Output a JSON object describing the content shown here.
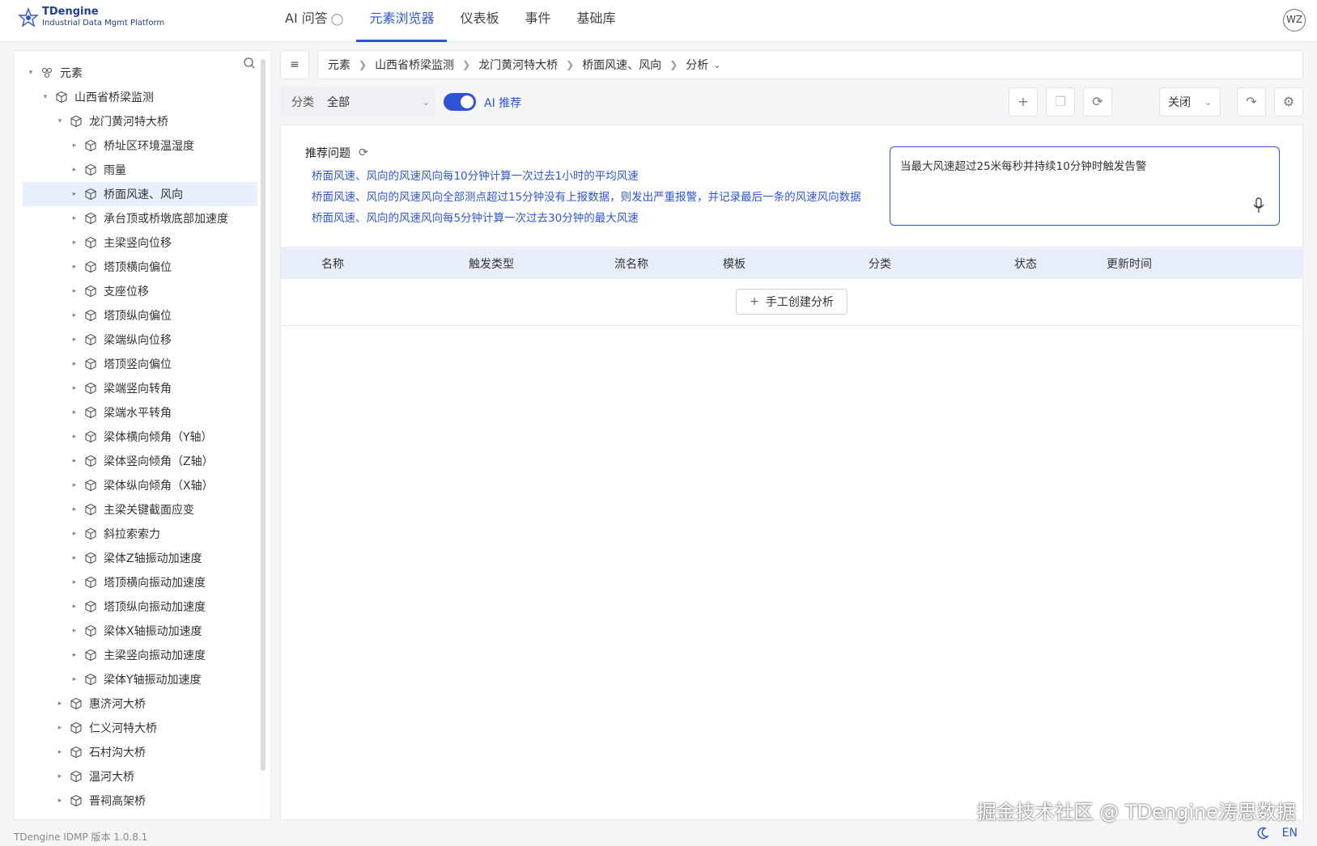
{
  "app": {
    "logo_title": "TDengine",
    "logo_subtitle": "Industrial Data Mgmt Platform",
    "avatar": "WZ",
    "version_text": "TDengine IDMP 版本 1.0.8.1",
    "lang": "EN",
    "watermark": "掘金技术社区 @ TDengine涛思数据"
  },
  "nav": [
    {
      "label": "AI 问答",
      "icon": "bulb-icon",
      "active": false
    },
    {
      "label": "元素浏览器",
      "active": true
    },
    {
      "label": "仪表板",
      "active": false
    },
    {
      "label": "事件",
      "active": false
    },
    {
      "label": "基础库",
      "active": false
    }
  ],
  "tree": {
    "root": "元素",
    "level1": "山西省桥梁监测",
    "level2": "龙门黄河特大桥",
    "children": [
      "桥址区环境温湿度",
      "雨量",
      "桥面风速、风向",
      "承台顶或桥墩底部加速度",
      "主梁竖向位移",
      "塔顶横向偏位",
      "支座位移",
      "塔顶纵向偏位",
      "梁端纵向位移",
      "塔顶竖向偏位",
      "梁端竖向转角",
      "梁端水平转角",
      "梁体横向倾角（Y轴）",
      "梁体竖向倾角（Z轴）",
      "梁体纵向倾角（X轴）",
      "主梁关键截面应变",
      "斜拉索索力",
      "梁体Z轴振动加速度",
      "塔顶横向振动加速度",
      "塔顶纵向振动加速度",
      "梁体X轴振动加速度",
      "主梁竖向振动加速度",
      "梁体Y轴振动加速度"
    ],
    "selected_index": 2,
    "siblings": [
      "惠济河大桥",
      "仁义河特大桥",
      "石村沟大桥",
      "温河大桥",
      "晋祠高架桥"
    ]
  },
  "breadcrumb": [
    "元素",
    "山西省桥梁监测",
    "龙门黄河特大桥",
    "桥面风速、风向",
    "分析"
  ],
  "toolbar": {
    "filter_label": "分类",
    "filter_value": "全部",
    "ai_toggle_on": true,
    "ai_label": "AI 推荐",
    "status_select": "关闭"
  },
  "recommend": {
    "title": "推荐问题",
    "items": [
      "桥面风速、风向的风速风向每10分钟计算一次过去1小时的平均风速",
      "桥面风速、风向的风速风向全部测点超过15分钟没有上报数据，则发出严重报警，并记录最后一条的风速风向数据",
      "桥面风速、风向的风速风向每5分钟计算一次过去30分钟的最大风速"
    ],
    "input_value": "当最大风速超过25米每秒并持续10分钟时触发告警"
  },
  "table": {
    "headers": [
      "名称",
      "触发类型",
      "流名称",
      "模板",
      "分类",
      "状态",
      "更新时间"
    ],
    "create_label": "手工创建分析"
  },
  "colors": {
    "accent": "#2f55d4",
    "selected_row": "#e8f0fe",
    "table_header": "#e8eef9"
  }
}
